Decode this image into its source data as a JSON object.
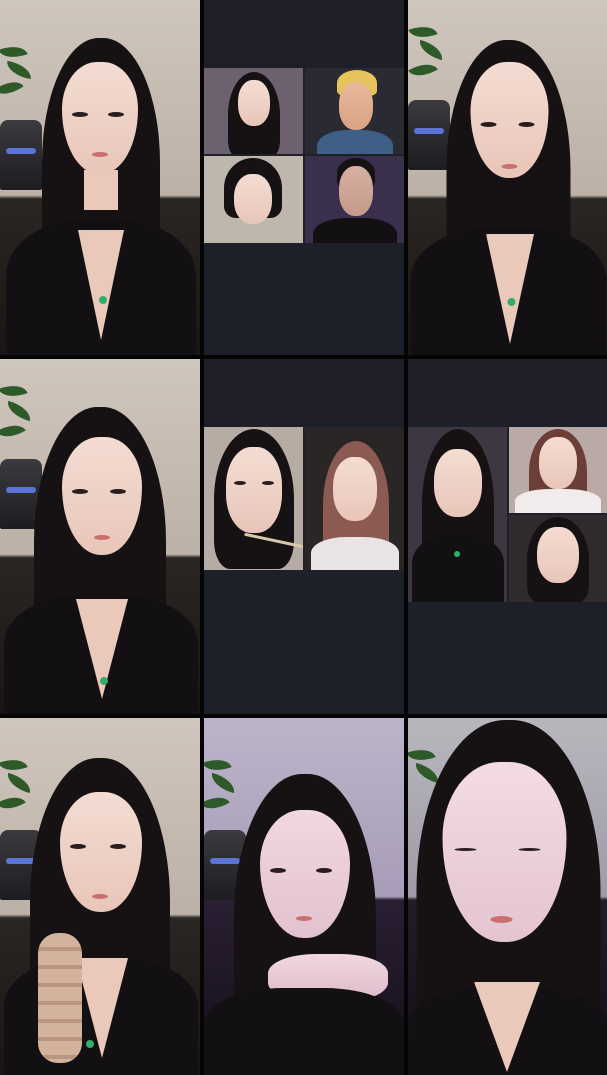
{
  "tiles": [
    {
      "id": "solo-1",
      "kind": "solo"
    },
    {
      "id": "call-1",
      "kind": "group-call",
      "participants": 4
    },
    {
      "id": "solo-2",
      "kind": "solo"
    },
    {
      "id": "solo-3",
      "kind": "solo"
    },
    {
      "id": "call-2",
      "kind": "group-call",
      "participants": 2
    },
    {
      "id": "call-3",
      "kind": "group-call",
      "participants": 3
    },
    {
      "id": "solo-4",
      "kind": "solo"
    },
    {
      "id": "solo-5",
      "kind": "solo"
    },
    {
      "id": "solo-6",
      "kind": "solo"
    }
  ],
  "colors": {
    "divider": "#050505",
    "call_background": "#1f2028",
    "hair": "#161213",
    "skin": "#f4dcd2",
    "top": "#121012",
    "pendant": "#2fae6e"
  }
}
